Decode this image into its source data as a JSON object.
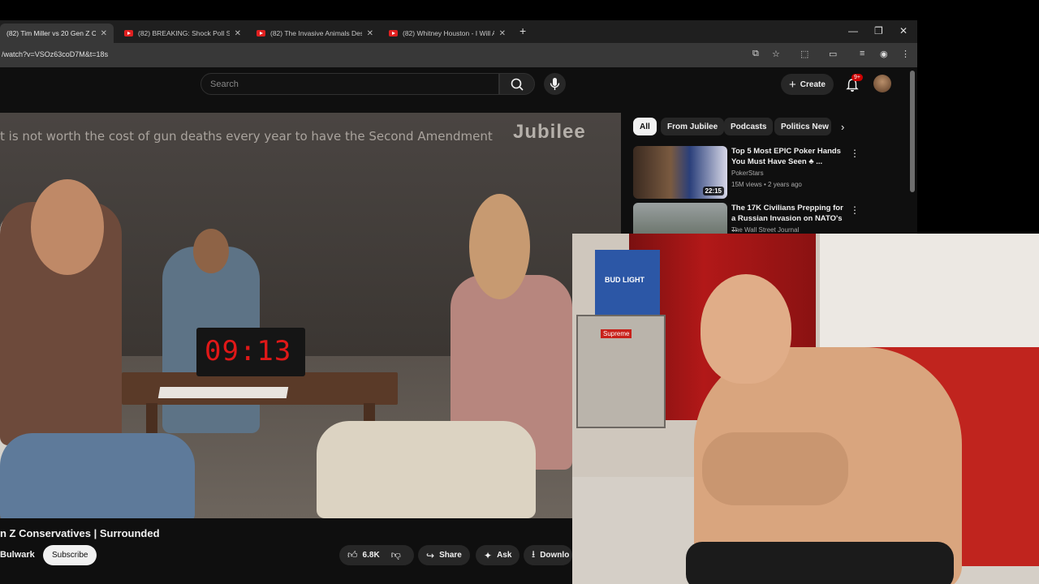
{
  "tabs": [
    {
      "label": "(82) Tim Miller vs 20 Gen Z Con",
      "active": true
    },
    {
      "label": "(82) BREAKING: Shock Poll Sho",
      "active": false
    },
    {
      "label": "(82) The Invasive Animals Dest",
      "active": false
    },
    {
      "label": "(82) Whitney Houston - I Will A",
      "active": false
    }
  ],
  "address": {
    "url": "/watch?v=VSOz63coD7M&t=18s"
  },
  "header": {
    "search_placeholder": "Search",
    "create_label": "Create",
    "notification_count": "9+"
  },
  "video": {
    "caption": "t is not worth the cost of gun deaths every year to have the Second Amendment",
    "brand": "Jubilee",
    "timer": "09:13",
    "title": "n Z Conservatives | Surrounded",
    "channel": "Bulwark",
    "subscribe_label": "Subscribe",
    "like_count": "6.8K",
    "share_label": "Share",
    "ask_label": "Ask",
    "download_label": "Downlo"
  },
  "sidebar": {
    "chips": [
      "All",
      "From Jubilee",
      "Podcasts",
      "Politics New"
    ],
    "recommendations": [
      {
        "title": "Top 5 Most EPIC Poker Hands You Must Have Seen ♣ ...",
        "channel": "PokerStars",
        "meta": "15M views • 2 years ago",
        "duration": "22:15"
      },
      {
        "title": "The 17K Civilians Prepping for a Russian Invasion on NATO's ...",
        "channel": "The Wall Street Journal",
        "meta": "",
        "duration": ""
      }
    ]
  },
  "webcam": {
    "box_text": "BUD LIGHT",
    "sticker_text": "Supreme"
  },
  "colors": {
    "youtube_bg": "#0f0f0f",
    "accent_red": "#cc0000",
    "timer_red": "#e01818"
  }
}
